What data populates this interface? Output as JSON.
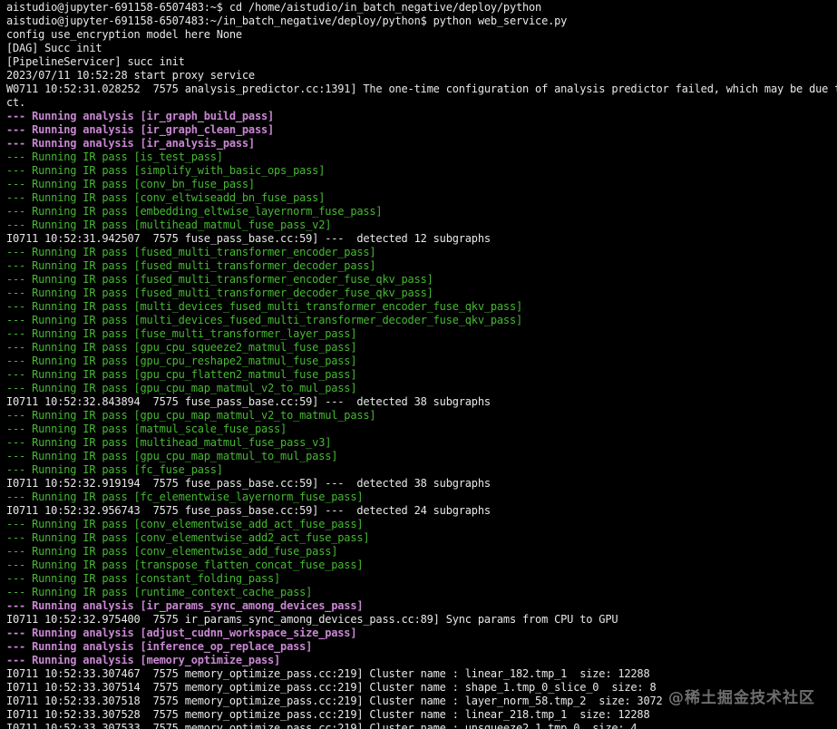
{
  "terminal": {
    "colors": {
      "background": "#000000",
      "default": "#e8e8e8",
      "green": "#47b833",
      "purple": "#c887d2"
    },
    "lines": [
      {
        "text": "aistudio@jupyter-691158-6507483:~$ cd /home/aistudio/in_batch_negative/deploy/python",
        "color": "default"
      },
      {
        "text": "aistudio@jupyter-691158-6507483:~/in_batch_negative/deploy/python$ python web_service.py",
        "color": "default"
      },
      {
        "text": "config use_encryption model here None",
        "color": "default"
      },
      {
        "text": "[DAG] Succ init",
        "color": "default"
      },
      {
        "text": "[PipelineServicer] succ init",
        "color": "default"
      },
      {
        "text": "2023/07/11 10:52:28 start proxy service",
        "color": "default"
      },
      {
        "text": "W0711 10:52:31.028252  7575 analysis_predictor.cc:1391] The one-time configuration of analysis predictor failed, which may be due t",
        "color": "default"
      },
      {
        "text": "ct.",
        "color": "default"
      },
      {
        "text": "--- Running analysis [ir_graph_build_pass]",
        "color": "purple"
      },
      {
        "text": "--- Running analysis [ir_graph_clean_pass]",
        "color": "purple"
      },
      {
        "text": "--- Running analysis [ir_analysis_pass]",
        "color": "purple"
      },
      {
        "text": "--- Running IR pass [is_test_pass]",
        "color": "green"
      },
      {
        "text": "--- Running IR pass [simplify_with_basic_ops_pass]",
        "color": "green"
      },
      {
        "text": "--- Running IR pass [conv_bn_fuse_pass]",
        "color": "green"
      },
      {
        "text": "--- Running IR pass [conv_eltwiseadd_bn_fuse_pass]",
        "color": "green"
      },
      {
        "text": "--- Running IR pass [embedding_eltwise_layernorm_fuse_pass]",
        "color": "green"
      },
      {
        "text": "--- Running IR pass [multihead_matmul_fuse_pass_v2]",
        "color": "green"
      },
      {
        "text": "I0711 10:52:31.942507  7575 fuse_pass_base.cc:59] ---  detected 12 subgraphs",
        "color": "default"
      },
      {
        "text": "--- Running IR pass [fused_multi_transformer_encoder_pass]",
        "color": "green"
      },
      {
        "text": "--- Running IR pass [fused_multi_transformer_decoder_pass]",
        "color": "green"
      },
      {
        "text": "--- Running IR pass [fused_multi_transformer_encoder_fuse_qkv_pass]",
        "color": "green"
      },
      {
        "text": "--- Running IR pass [fused_multi_transformer_decoder_fuse_qkv_pass]",
        "color": "green"
      },
      {
        "text": "--- Running IR pass [multi_devices_fused_multi_transformer_encoder_fuse_qkv_pass]",
        "color": "green"
      },
      {
        "text": "--- Running IR pass [multi_devices_fused_multi_transformer_decoder_fuse_qkv_pass]",
        "color": "green"
      },
      {
        "text": "--- Running IR pass [fuse_multi_transformer_layer_pass]",
        "color": "green"
      },
      {
        "text": "--- Running IR pass [gpu_cpu_squeeze2_matmul_fuse_pass]",
        "color": "green"
      },
      {
        "text": "--- Running IR pass [gpu_cpu_reshape2_matmul_fuse_pass]",
        "color": "green"
      },
      {
        "text": "--- Running IR pass [gpu_cpu_flatten2_matmul_fuse_pass]",
        "color": "green"
      },
      {
        "text": "--- Running IR pass [gpu_cpu_map_matmul_v2_to_mul_pass]",
        "color": "green"
      },
      {
        "text": "I0711 10:52:32.843894  7575 fuse_pass_base.cc:59] ---  detected 38 subgraphs",
        "color": "default"
      },
      {
        "text": "--- Running IR pass [gpu_cpu_map_matmul_v2_to_matmul_pass]",
        "color": "green"
      },
      {
        "text": "--- Running IR pass [matmul_scale_fuse_pass]",
        "color": "green"
      },
      {
        "text": "--- Running IR pass [multihead_matmul_fuse_pass_v3]",
        "color": "green"
      },
      {
        "text": "--- Running IR pass [gpu_cpu_map_matmul_to_mul_pass]",
        "color": "green"
      },
      {
        "text": "--- Running IR pass [fc_fuse_pass]",
        "color": "green"
      },
      {
        "text": "I0711 10:52:32.919194  7575 fuse_pass_base.cc:59] ---  detected 38 subgraphs",
        "color": "default"
      },
      {
        "text": "--- Running IR pass [fc_elementwise_layernorm_fuse_pass]",
        "color": "green"
      },
      {
        "text": "I0711 10:52:32.956743  7575 fuse_pass_base.cc:59] ---  detected 24 subgraphs",
        "color": "default"
      },
      {
        "text": "--- Running IR pass [conv_elementwise_add_act_fuse_pass]",
        "color": "green"
      },
      {
        "text": "--- Running IR pass [conv_elementwise_add2_act_fuse_pass]",
        "color": "green"
      },
      {
        "text": "--- Running IR pass [conv_elementwise_add_fuse_pass]",
        "color": "green"
      },
      {
        "text": "--- Running IR pass [transpose_flatten_concat_fuse_pass]",
        "color": "green"
      },
      {
        "text": "--- Running IR pass [constant_folding_pass]",
        "color": "green"
      },
      {
        "text": "--- Running IR pass [runtime_context_cache_pass]",
        "color": "green"
      },
      {
        "text": "--- Running analysis [ir_params_sync_among_devices_pass]",
        "color": "purple"
      },
      {
        "text": "I0711 10:52:32.975400  7575 ir_params_sync_among_devices_pass.cc:89] Sync params from CPU to GPU",
        "color": "default"
      },
      {
        "text": "--- Running analysis [adjust_cudnn_workspace_size_pass]",
        "color": "purple"
      },
      {
        "text": "--- Running analysis [inference_op_replace_pass]",
        "color": "purple"
      },
      {
        "text": "--- Running analysis [memory_optimize_pass]",
        "color": "purple"
      },
      {
        "text": "I0711 10:52:33.307467  7575 memory_optimize_pass.cc:219] Cluster name : linear_182.tmp_1  size: 12288",
        "color": "default"
      },
      {
        "text": "I0711 10:52:33.307514  7575 memory_optimize_pass.cc:219] Cluster name : shape_1.tmp_0_slice_0  size: 8",
        "color": "default"
      },
      {
        "text": "I0711 10:52:33.307518  7575 memory_optimize_pass.cc:219] Cluster name : layer_norm_58.tmp_2  size: 3072",
        "color": "default"
      },
      {
        "text": "I0711 10:52:33.307528  7575 memory_optimize_pass.cc:219] Cluster name : linear_218.tmp_1  size: 12288",
        "color": "default"
      },
      {
        "text": "I0711 10:52:33.307533  7575 memory_optimize_pass.cc:219] Cluster name : unsqueeze2_1.tmp_0  size: 4",
        "color": "default"
      }
    ]
  },
  "watermark": {
    "text": "@稀土掘金技术社区"
  }
}
